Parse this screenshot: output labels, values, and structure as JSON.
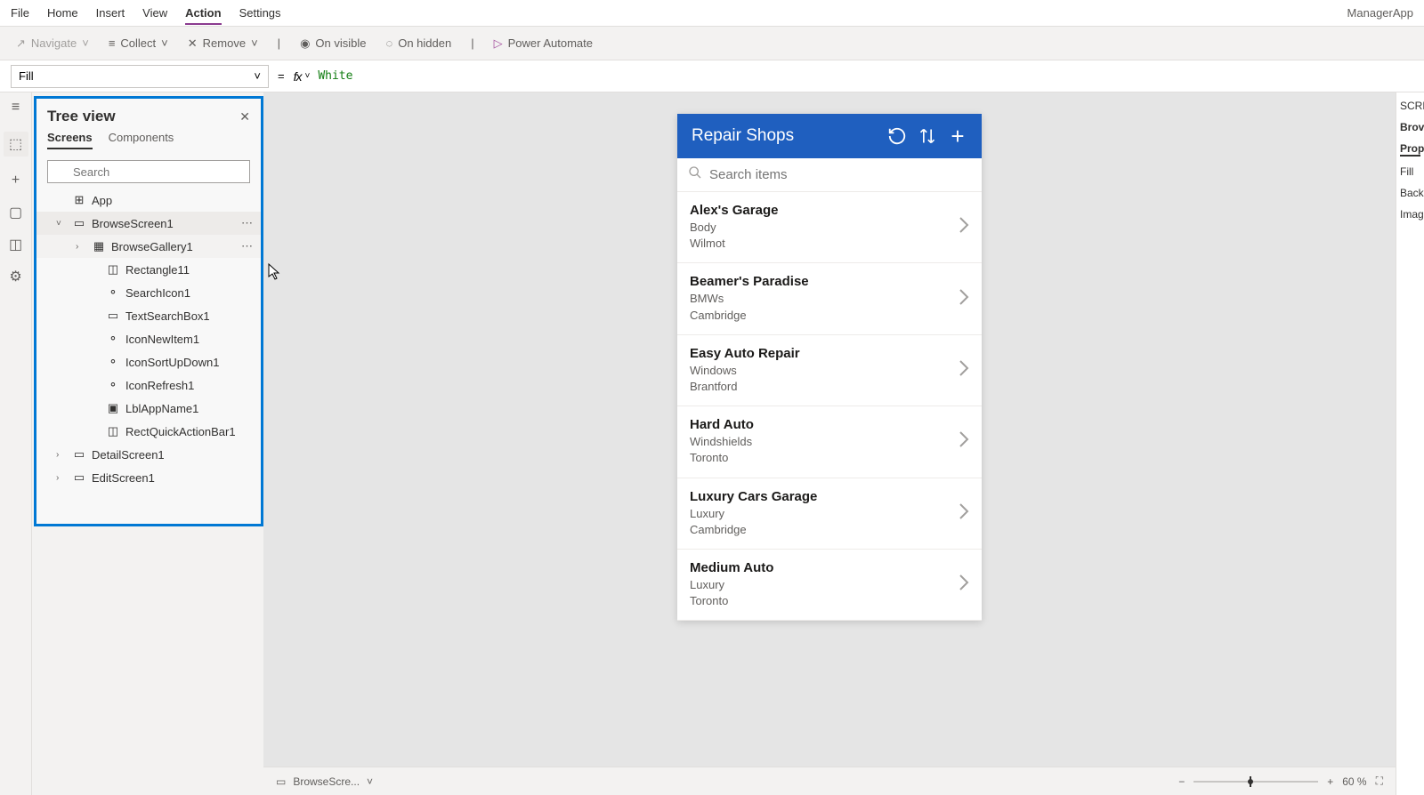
{
  "menu": {
    "items": [
      "File",
      "Home",
      "Insert",
      "View",
      "Action",
      "Settings"
    ],
    "active_index": 4,
    "app_name": "ManagerApp"
  },
  "ribbon": {
    "navigate": "Navigate",
    "collect": "Collect",
    "remove": "Remove",
    "on_visible": "On visible",
    "on_hidden": "On hidden",
    "power_automate": "Power Automate"
  },
  "formula": {
    "property": "Fill",
    "equals": "=",
    "fx": "fx",
    "value": "White"
  },
  "tree": {
    "title": "Tree view",
    "tabs": [
      "Screens",
      "Components"
    ],
    "active_tab": 0,
    "search_placeholder": "Search",
    "items": [
      {
        "label": "App",
        "indent": 1,
        "icon": "app"
      },
      {
        "label": "BrowseScreen1",
        "indent": 1,
        "icon": "screen",
        "chevron": "down",
        "more": true,
        "selected": true
      },
      {
        "label": "BrowseGallery1",
        "indent": 2,
        "icon": "gallery",
        "chevron": "right",
        "hovered": true,
        "more": true
      },
      {
        "label": "Rectangle11",
        "indent": 3,
        "icon": "rect"
      },
      {
        "label": "SearchIcon1",
        "indent": 3,
        "icon": "control"
      },
      {
        "label": "TextSearchBox1",
        "indent": 3,
        "icon": "textbox"
      },
      {
        "label": "IconNewItem1",
        "indent": 3,
        "icon": "control"
      },
      {
        "label": "IconSortUpDown1",
        "indent": 3,
        "icon": "control"
      },
      {
        "label": "IconRefresh1",
        "indent": 3,
        "icon": "control"
      },
      {
        "label": "LblAppName1",
        "indent": 3,
        "icon": "label"
      },
      {
        "label": "RectQuickActionBar1",
        "indent": 3,
        "icon": "rect"
      },
      {
        "label": "DetailScreen1",
        "indent": 1,
        "icon": "screen",
        "chevron": "right"
      },
      {
        "label": "EditScreen1",
        "indent": 1,
        "icon": "screen",
        "chevron": "right"
      }
    ]
  },
  "app": {
    "title": "Repair Shops",
    "search_placeholder": "Search items",
    "items": [
      {
        "title": "Alex's Garage",
        "sub1": "Body",
        "sub2": "Wilmot"
      },
      {
        "title": "Beamer's Paradise",
        "sub1": "BMWs",
        "sub2": "Cambridge"
      },
      {
        "title": "Easy Auto Repair",
        "sub1": "Windows",
        "sub2": "Brantford"
      },
      {
        "title": "Hard Auto",
        "sub1": "Windshields",
        "sub2": "Toronto"
      },
      {
        "title": "Luxury Cars Garage",
        "sub1": "Luxury",
        "sub2": "Cambridge"
      },
      {
        "title": "Medium Auto",
        "sub1": "Luxury",
        "sub2": "Toronto"
      }
    ]
  },
  "status": {
    "screen_label": "BrowseScre...",
    "zoom": "60",
    "zoom_unit": "%"
  },
  "right": {
    "heading": "SCRE",
    "sub": "Brov",
    "prop": "Prop",
    "fill": "Fill",
    "back": "Back",
    "imag": "Imag"
  }
}
